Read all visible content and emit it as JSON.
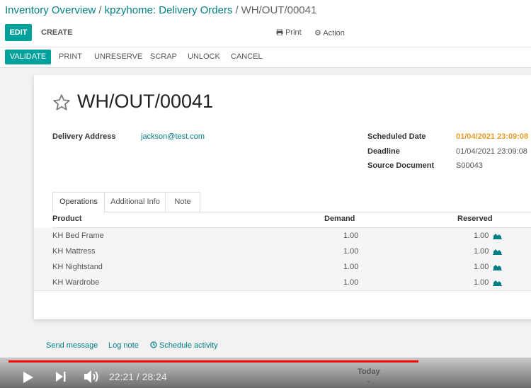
{
  "breadcrumb": {
    "items": [
      "Inventory Overview",
      "kpzyhome: Delivery Orders"
    ],
    "current": "WH/OUT/00041",
    "separator": "/"
  },
  "control_panel": {
    "edit": "EDIT",
    "create": "CREATE",
    "print": "Print",
    "action": "Action"
  },
  "status_bar": {
    "buttons": [
      "VALIDATE",
      "PRINT",
      "UNRESERVE",
      "SCRAP",
      "UNLOCK",
      "CANCEL"
    ]
  },
  "record": {
    "name": "WH/OUT/00041",
    "delivery_address_label": "Delivery Address",
    "delivery_address": "jackson@test.com",
    "scheduled_date_label": "Scheduled Date",
    "scheduled_date": "01/04/2021 23:09:08",
    "deadline_label": "Deadline",
    "deadline": "01/04/2021 23:09:08",
    "source_document_label": "Source Document",
    "source_document": "S00043"
  },
  "tabs": [
    "Operations",
    "Additional Info",
    "Note"
  ],
  "table": {
    "headers": [
      "Product",
      "Demand",
      "Reserved"
    ],
    "rows": [
      {
        "product": "KH Bed Frame",
        "demand": "1.00",
        "reserved": "1.00"
      },
      {
        "product": "KH Mattress",
        "demand": "1.00",
        "reserved": "1.00"
      },
      {
        "product": "KH Nightstand",
        "demand": "1.00",
        "reserved": "1.00"
      },
      {
        "product": "KH Wardrobe",
        "demand": "1.00",
        "reserved": "1.00"
      }
    ]
  },
  "chatter": {
    "send_message": "Send message",
    "log_note": "Log note",
    "schedule_activity": "Schedule activity"
  },
  "player": {
    "time": "22:21 / 28:24",
    "progress": 0.785
  },
  "today_label": "Today",
  "colors": {
    "accent": "#00a09d",
    "link": "#017e84",
    "warning_date": "#e99d28",
    "progress": "#ff0000"
  },
  "icons": [
    "star-icon",
    "print-icon",
    "gear-icon",
    "area-chart-icon",
    "clock-icon",
    "play-icon",
    "next-icon",
    "volume-icon",
    "chevron-down-icon"
  ]
}
